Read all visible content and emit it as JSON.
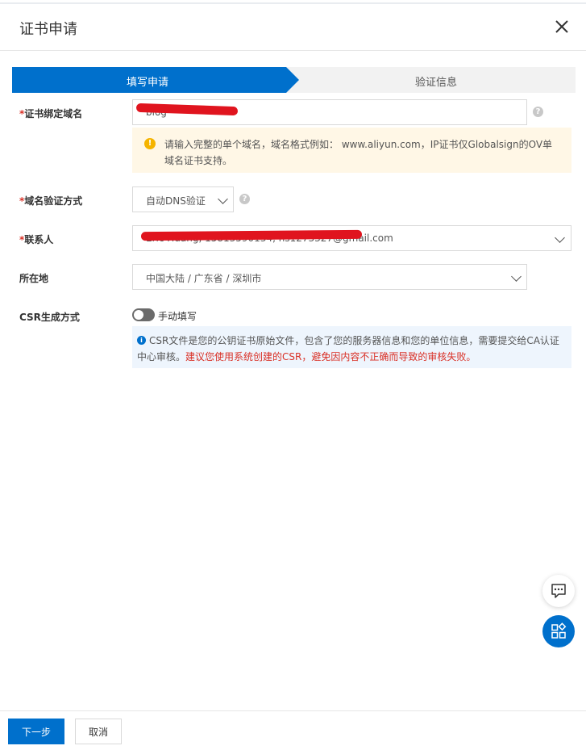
{
  "dialog": {
    "title": "证书申请"
  },
  "steps": [
    {
      "label": "填写申请",
      "active": true
    },
    {
      "label": "验证信息",
      "active": false
    }
  ],
  "form": {
    "domain": {
      "required_mark": "*",
      "label": "证书绑定域名",
      "value": "blog",
      "notice": "请输入完整的单个域名，域名格式例如： www.aliyun.com，IP证书仅Globalsign的OV单域名证书支持。"
    },
    "verify_method": {
      "required_mark": "*",
      "label": "域名验证方式",
      "selected": "自动DNS验证"
    },
    "contact": {
      "required_mark": "*",
      "label": "联系人",
      "value": "Eric Huang, 15813590134, hs1273327@gmail.com"
    },
    "location": {
      "label": "所在地",
      "value": "中国大陆 / 广东省 / 深圳市"
    },
    "csr": {
      "label": "CSR生成方式",
      "toggle_label": "手动填写",
      "toggle_on": false,
      "info_text": "CSR文件是您的公钥证书原始文件，包含了您的服务器信息和您的单位信息，需要提交给CA认证中心审核。",
      "warning_text": "建议您使用系统创建的CSR，避免因内容不正确而导致的审核失败。"
    }
  },
  "colors": {
    "primary": "#0070cc",
    "required": "#d93026",
    "warning_bg": "#fff7e6",
    "info_bg": "#eef5fd"
  },
  "footer": {
    "next_label": "下一步",
    "cancel_label": "取消"
  },
  "floating": {
    "chat_icon": "chat-bubble-icon",
    "apps_icon": "apps-grid-icon"
  }
}
